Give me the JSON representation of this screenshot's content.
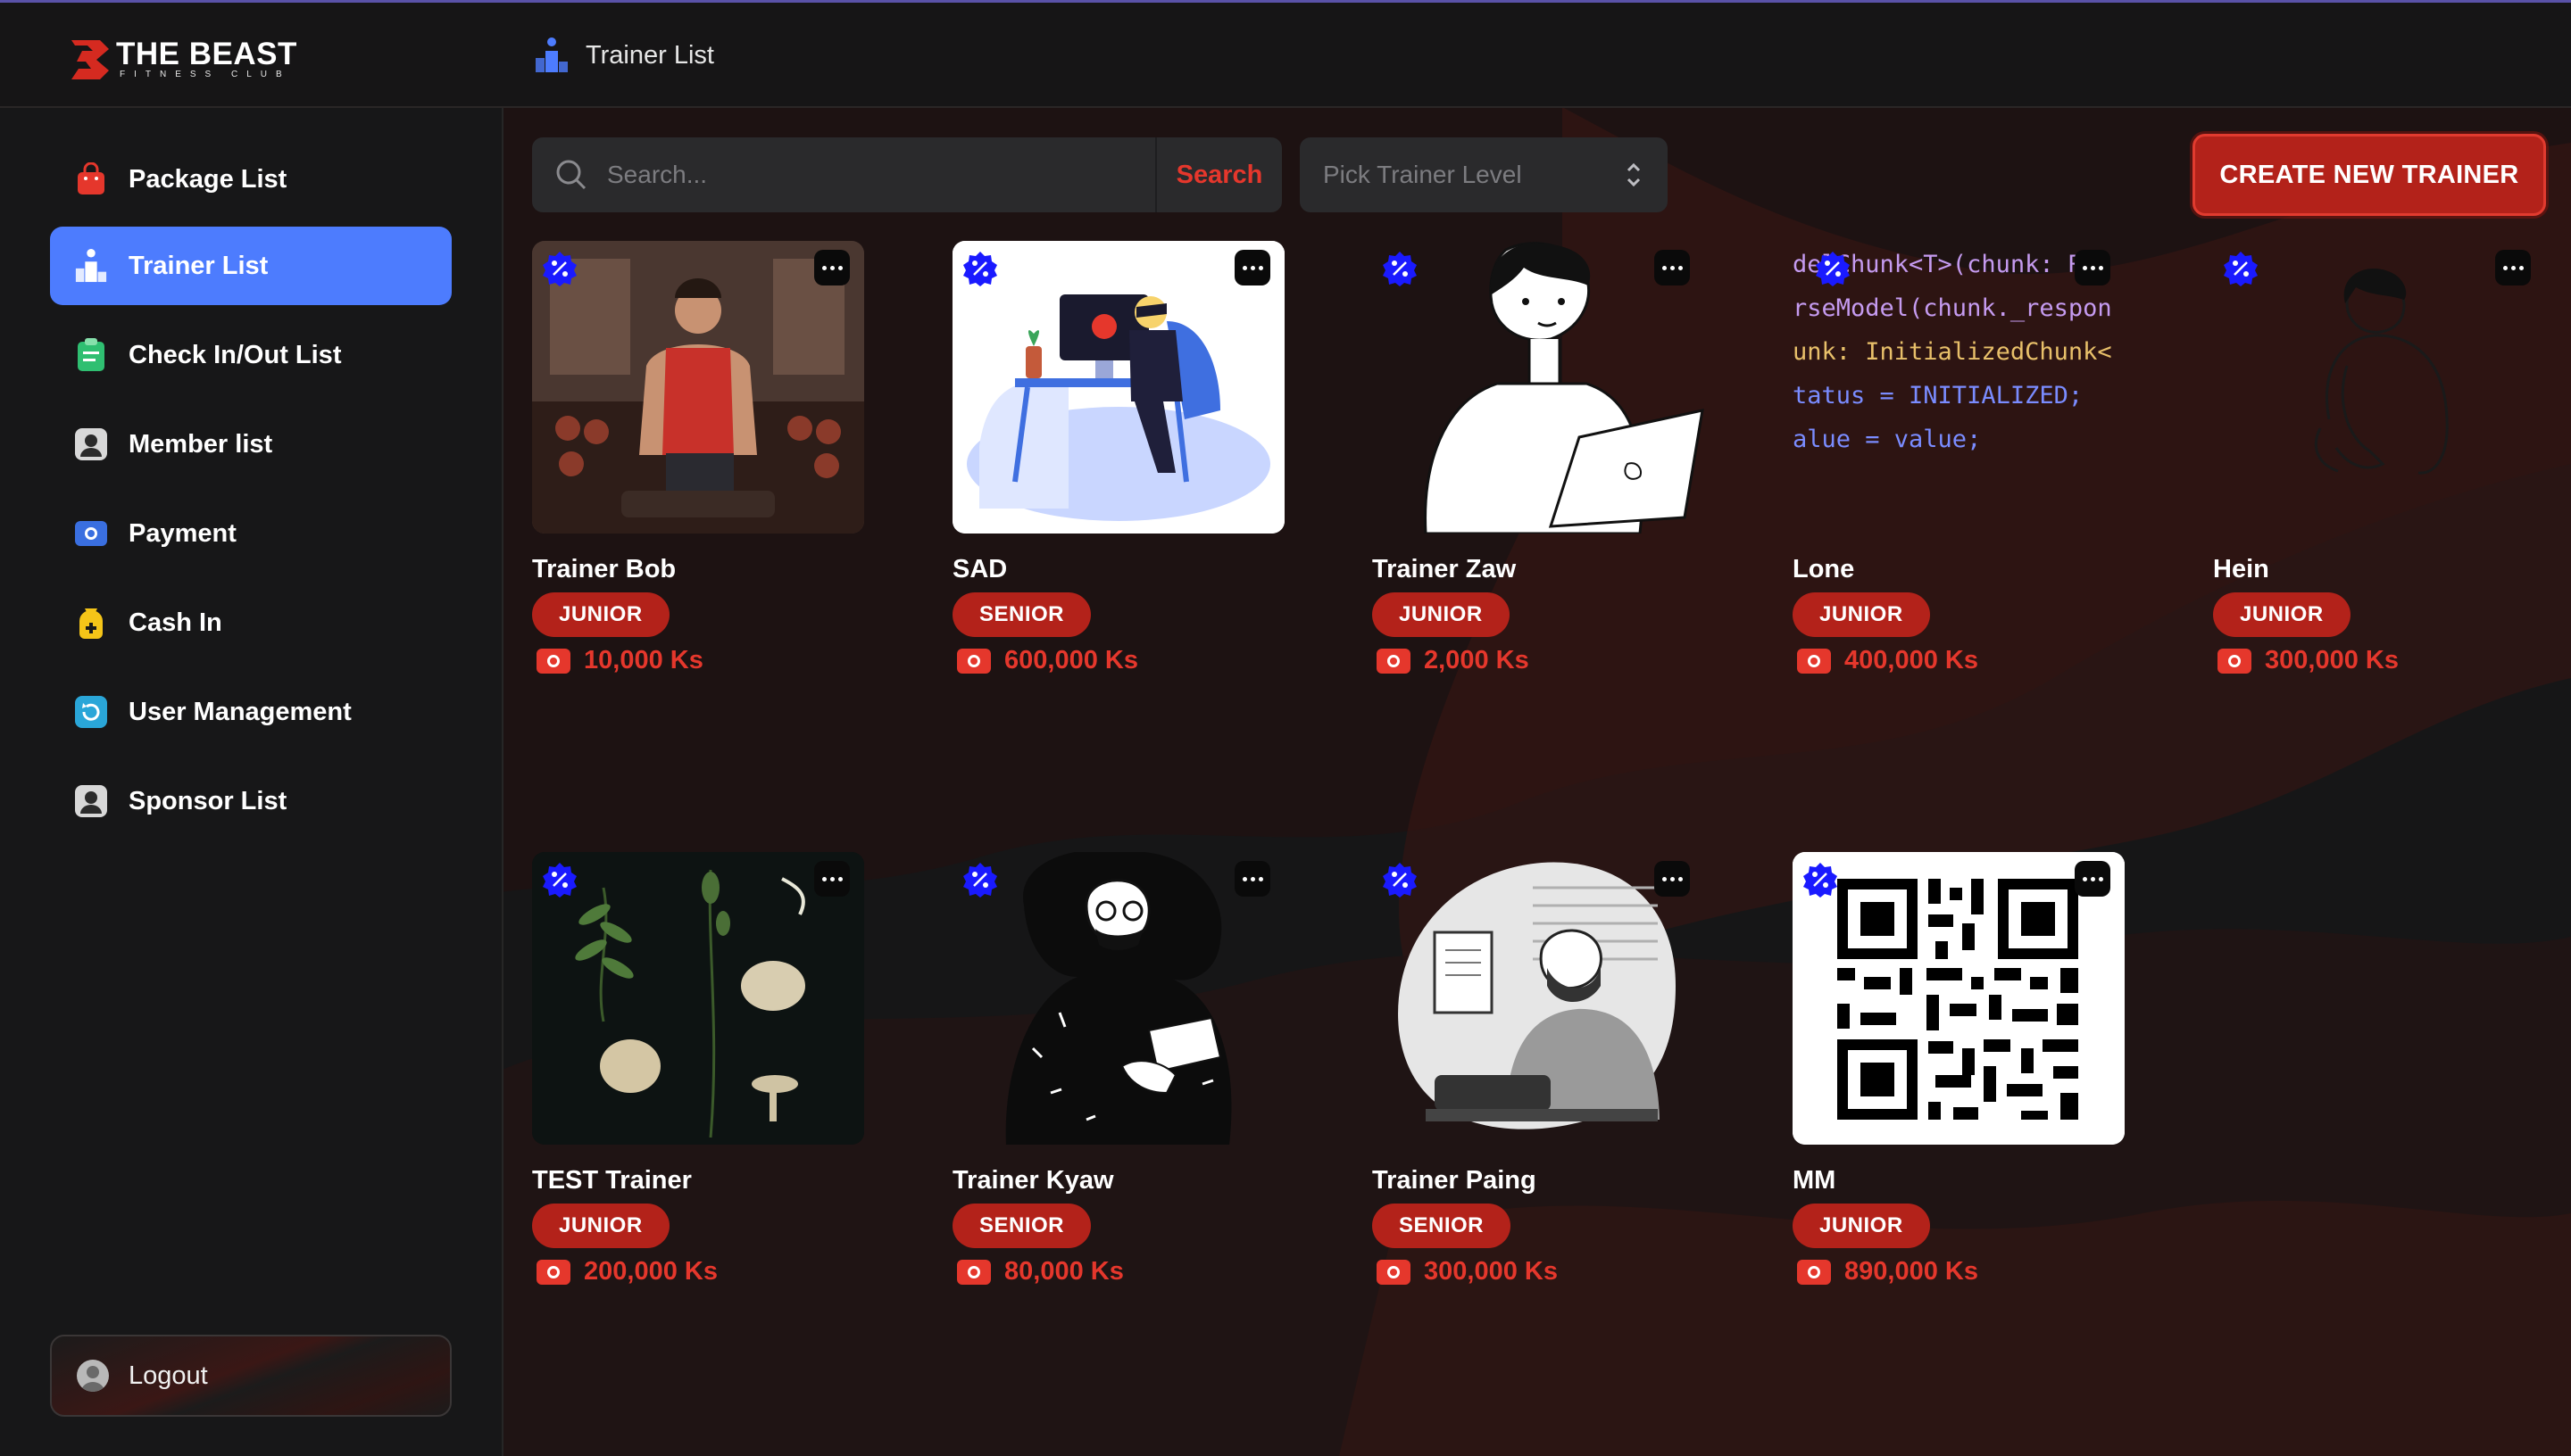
{
  "app": {
    "brand_title": "THE BEAST",
    "brand_subtitle": "FITNESS CLUB"
  },
  "header": {
    "page_title": "Trainer List"
  },
  "sidebar": {
    "items": [
      {
        "label": "Package List",
        "icon": "shopping-bag-icon",
        "active": false
      },
      {
        "label": "Trainer List",
        "icon": "podium-icon",
        "active": true
      },
      {
        "label": "Check In/Out List",
        "icon": "clipboard-icon",
        "active": false
      },
      {
        "label": "Member list",
        "icon": "member-icon",
        "active": false
      },
      {
        "label": "Payment",
        "icon": "cash-icon",
        "active": false
      },
      {
        "label": "Cash In",
        "icon": "cash-bag-icon",
        "active": false
      },
      {
        "label": "User Management",
        "icon": "user-cycle-icon",
        "active": false
      },
      {
        "label": "Sponsor List",
        "icon": "sponsor-icon",
        "active": false
      }
    ],
    "logout_label": "Logout"
  },
  "toolbar": {
    "search_placeholder": "Search...",
    "search_button": "Search",
    "level_placeholder": "Pick Trainer Level",
    "create_button": "CREATE NEW TRAINER"
  },
  "trainers": [
    {
      "name": "Trainer Bob",
      "level": "JUNIOR",
      "price": "10,000 Ks"
    },
    {
      "name": "SAD",
      "level": "SENIOR",
      "price": "600,000 Ks"
    },
    {
      "name": "Trainer Zaw",
      "level": "JUNIOR",
      "price": "2,000 Ks"
    },
    {
      "name": "Lone",
      "level": "JUNIOR",
      "price": "400,000 Ks"
    },
    {
      "name": "Hein",
      "level": "JUNIOR",
      "price": "300,000 Ks"
    },
    {
      "name": "TEST Trainer",
      "level": "JUNIOR",
      "price": "200,000 Ks"
    },
    {
      "name": "Trainer Kyaw",
      "level": "SENIOR",
      "price": "80,000 Ks"
    },
    {
      "name": "Trainer Paing",
      "level": "SENIOR",
      "price": "300,000 Ks"
    },
    {
      "name": "MM",
      "level": "JUNIOR",
      "price": "890,000 Ks"
    }
  ],
  "code_snippet": [
    "delChunk<T>(chunk: Res",
    "rseModel(chunk._respon",
    "unk: InitializedChunk<",
    "tatus = INITIALIZED;",
    "alue = value;"
  ],
  "colors": {
    "accent": "#4d7cfe",
    "brand_red": "#b3221a",
    "price_red": "#e5372c",
    "verified_blue": "#1a1aff"
  }
}
